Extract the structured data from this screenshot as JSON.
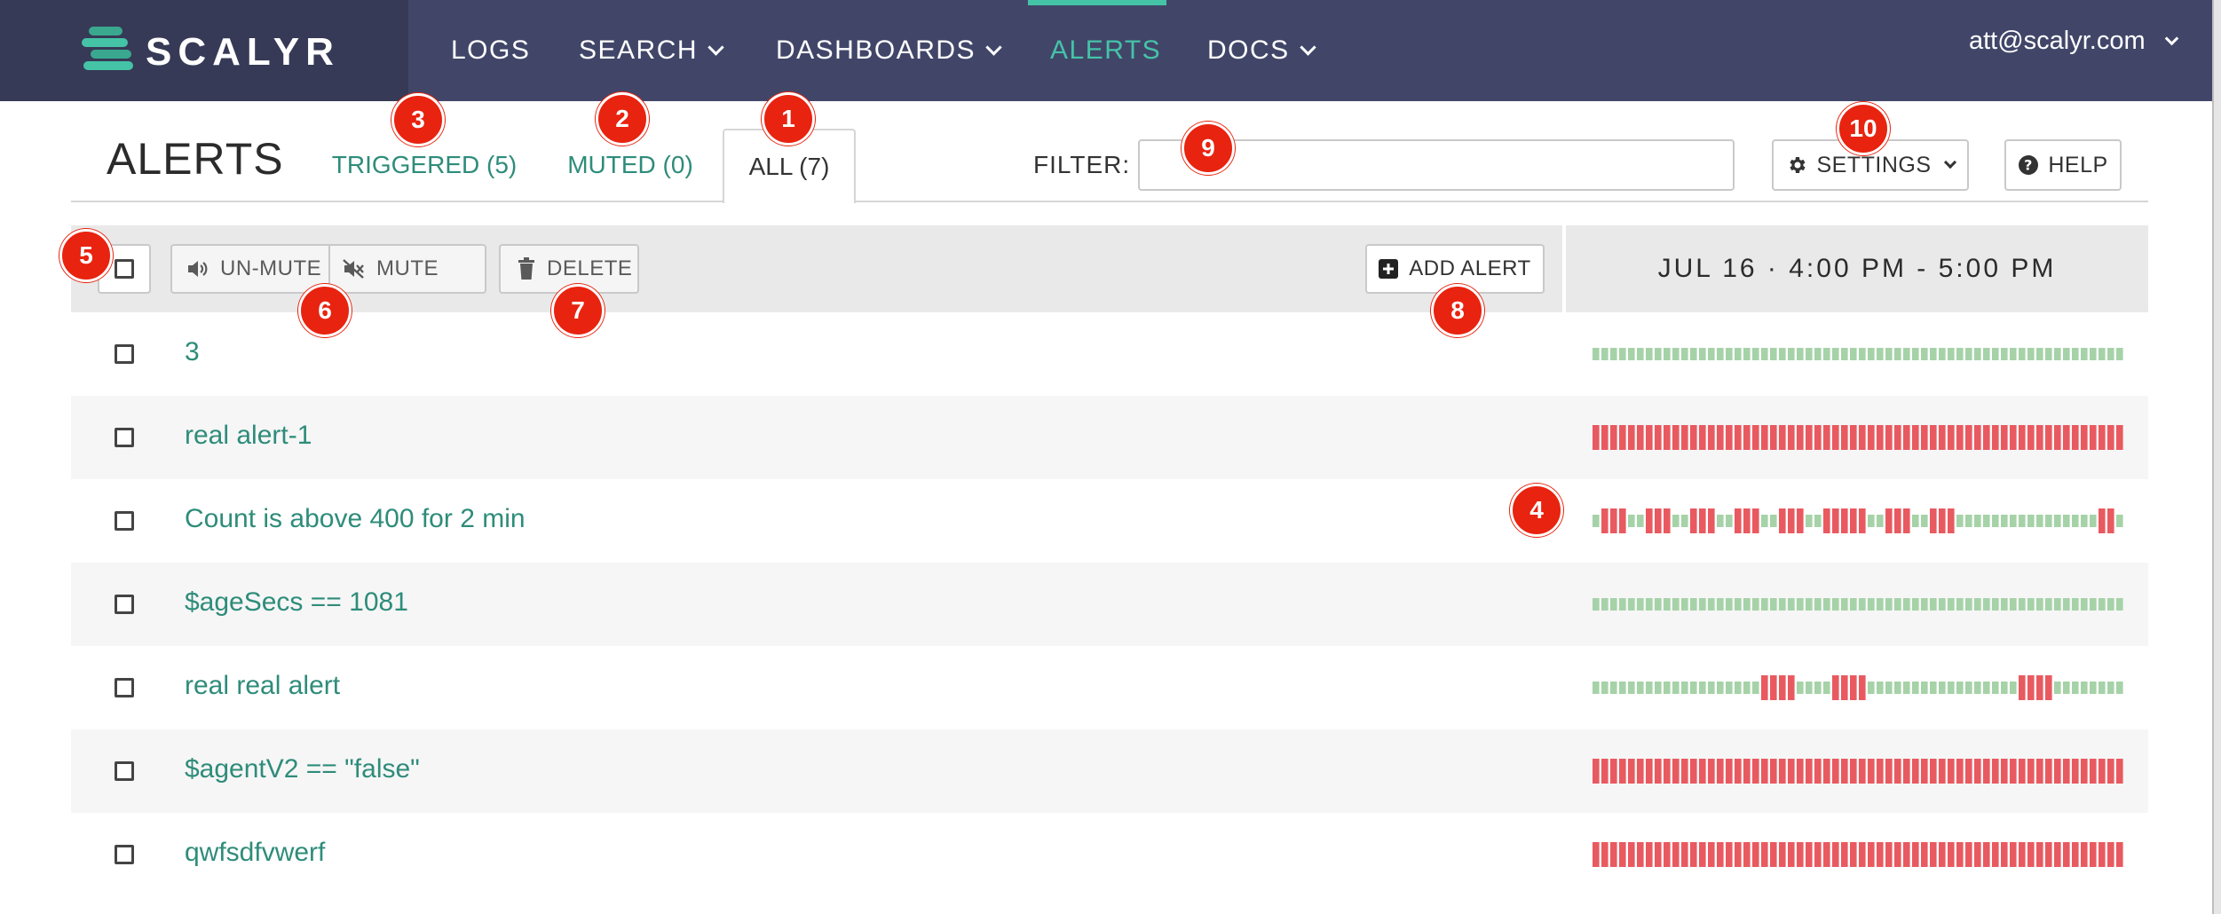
{
  "brand": {
    "name": "SCALYR"
  },
  "nav": {
    "items": [
      {
        "label": "LOGS",
        "has_dropdown": false,
        "active": false
      },
      {
        "label": "SEARCH",
        "has_dropdown": true,
        "active": false
      },
      {
        "label": "DASHBOARDS",
        "has_dropdown": true,
        "active": false
      },
      {
        "label": "ALERTS",
        "has_dropdown": false,
        "active": true
      },
      {
        "label": "DOCS",
        "has_dropdown": true,
        "active": false
      }
    ],
    "user": "att@scalyr.com",
    "active_color": "#45c3a6",
    "bg_color": "#414669"
  },
  "header": {
    "title": "ALERTS",
    "tabs": [
      {
        "label": "TRIGGERED (5)"
      },
      {
        "label": "MUTED (0)"
      },
      {
        "label": "ALL (7)",
        "selected": true
      }
    ],
    "filter_label": "FILTER:",
    "filter_value": "",
    "settings_label": "SETTINGS",
    "help_label": "HELP"
  },
  "toolbar": {
    "unmute_label": "UN-MUTE",
    "mute_label": "MUTE",
    "delete_label": "DELETE",
    "add_alert_label": "ADD ALERT",
    "time_range": "JUL 16 · 4:00 PM - 5:00 PM"
  },
  "alerts": [
    {
      "name": "3",
      "timeline": "000000000000000000000000000000000000000000000000000000000000"
    },
    {
      "name": "real alert-1",
      "timeline": "111111111111111111111111111111111111111111111111111111111111"
    },
    {
      "name": "Count is above 400 for 2 min",
      "timeline": "011100111001110011100111001111100111001110000000000000000110"
    },
    {
      "name": "$ageSecs == 1081",
      "timeline": "000000000000000000000000000000000000000000000000000000000000"
    },
    {
      "name": "real real alert",
      "timeline": "000000000000000000011110000111100000000000000000111100000000"
    },
    {
      "name": "$agentV2 == \"false\"",
      "timeline": "111111111111111111111111111111111111111111111111111111111111"
    },
    {
      "name": "qwfsdfvwerf",
      "timeline": "111111111111111111111111111111111111111111111111111111111111"
    }
  ],
  "timeline_colors": {
    "ok": "#a6d2a8",
    "triggered": "#e85a60"
  },
  "markers": [
    "1",
    "2",
    "3",
    "4",
    "5",
    "6",
    "7",
    "8",
    "9",
    "10"
  ]
}
